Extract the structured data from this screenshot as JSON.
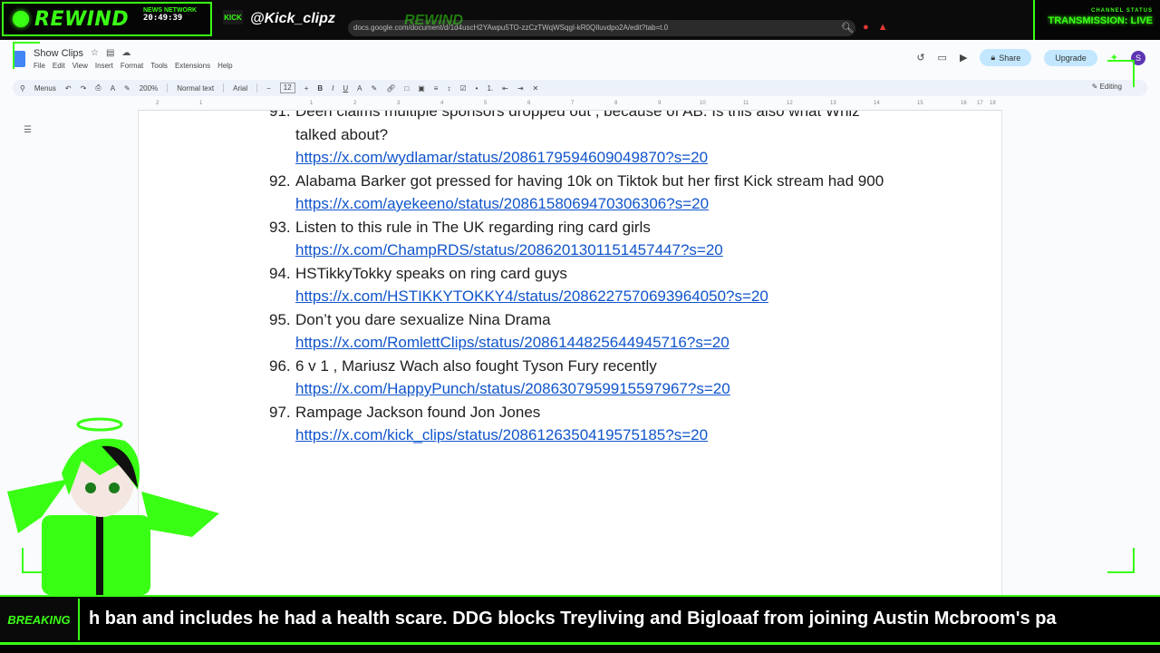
{
  "overlay": {
    "logo_text": "REWIND",
    "clock_label": "NEWS NETWORK",
    "clock_time": "20:49:39",
    "platform_badge": "KICK",
    "handle": "@Kick_clipz",
    "ghost_logo": "REWIND",
    "status_label": "CHANNEL STATUS",
    "status_value": "TRANSMISSION: LIVE",
    "accent_color": "#39ff14"
  },
  "browser": {
    "url": "docs.google.com/document/d/1d4uscH2YAwpu5TO-zzCzTWqWSqgI-kR0QIluvdpo2A/edit?tab=t.0"
  },
  "docs": {
    "title": "Show Clips",
    "menus": [
      "File",
      "Edit",
      "View",
      "Insert",
      "Format",
      "Tools",
      "Extensions",
      "Help"
    ],
    "share_label": "Share",
    "upgrade_label": "Upgrade",
    "avatar_initial": "S",
    "toolbar": {
      "menus_label": "Menus",
      "zoom": "200%",
      "style": "Normal text",
      "font": "Arial",
      "font_size": "12",
      "mode": "Editing"
    },
    "ruler_numbers": [
      "2",
      "1",
      "1",
      "2",
      "3",
      "4",
      "5",
      "6",
      "7",
      "8",
      "9",
      "10",
      "11",
      "12",
      "13",
      "14",
      "15",
      "16",
      "17",
      "18"
    ],
    "items": [
      {
        "num": "91.",
        "text": "Deen claims multiple sponsors dropped out , because of AB. Is this also what Whiz talked about?",
        "link": "https://x.com/wydlamar/status/2086179594609049870?s=20"
      },
      {
        "num": "92.",
        "text": "Alabama Barker got pressed for having 10k on Tiktok but her first Kick stream had 900",
        "link": "https://x.com/ayekeeno/status/2086158069470306306?s=20"
      },
      {
        "num": "93.",
        "text": "Listen to this rule in The UK regarding ring card girls",
        "link": "https://x.com/ChampRDS/status/2086201301151457447?s=20"
      },
      {
        "num": "94.",
        "text": "HSTikkyTokky speaks on ring card guys",
        "link": "https://x.com/HSTIKKYTOKKY4/status/2086227570693964050?s=20"
      },
      {
        "num": "95.",
        "text": "Don’t you dare sexualize Nina Drama",
        "link": "https://x.com/RomlettClips/status/2086144825644945716?s=20"
      },
      {
        "num": "96.",
        "text": "6 v 1 , Mariusz Wach also fought Tyson Fury recently",
        "link": "https://x.com/HappyPunch/status/2086307959915597967?s=20"
      },
      {
        "num": "97.",
        "text": "Rampage Jackson found Jon Jones",
        "link": "https://x.com/kick_clips/status/2086126350419575185?s=20"
      }
    ]
  },
  "ticker": {
    "label": "BREAKING",
    "text": "h ban and includes he had a health scare. DDG blocks Treyliving and Bigloaaf from joining Austin Mcbroom's pa"
  }
}
